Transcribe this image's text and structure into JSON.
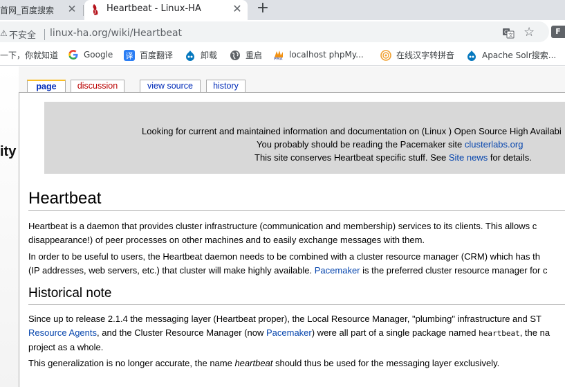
{
  "browser": {
    "tabs": [
      {
        "title": "首网_百度搜索",
        "active": false
      },
      {
        "title": "Heartbeat - Linux-HA",
        "active": true
      }
    ],
    "close_glyph": "✕",
    "new_tab_glyph": "+",
    "security_label": "不安全",
    "url": "linux-ha.org/wiki/Heartbeat",
    "profile_initial": "F",
    "bookmarks": [
      {
        "label": "一下，你就知道",
        "icon": "none"
      },
      {
        "label": "Google",
        "icon": "google-icon"
      },
      {
        "label": "百度翻译",
        "icon": "baidu-translate-icon"
      },
      {
        "label": "卸载",
        "icon": "drupal-icon"
      },
      {
        "label": "重启",
        "icon": "globe-icon"
      },
      {
        "label": "localhost phpMy...",
        "icon": "phpmyadmin-icon"
      },
      {
        "label": "在线汉字转拼音",
        "icon": "pinyin-icon"
      },
      {
        "label": "Apache Solr搜索...",
        "icon": "drupal-icon"
      }
    ]
  },
  "wiki": {
    "logo_fragment": "ity",
    "tabs": {
      "page": "page",
      "discussion": "discussion",
      "view_source": "view source",
      "history": "history"
    },
    "notice": {
      "line1": "Looking for current and maintained information and documentation on (Linux ) Open Source High Availabi",
      "line2_prefix": "You probably should be reading the Pacemaker site ",
      "line2_link": "clusterlabs.org",
      "line3_prefix": "This site conserves Heartbeat specific stuff. See ",
      "line3_link": "Site news",
      "line3_suffix": " for details."
    },
    "title": "Heartbeat",
    "paragraph1": {
      "line1": "Heartbeat is a daemon that provides cluster infrastructure (communication and membership) services to its clients. This allows c",
      "line2": "disappearance!) of peer processes on other machines and to easily exchange messages with them."
    },
    "paragraph2": {
      "line1": "In order to be useful to users, the Heartbeat daemon needs to be combined with a cluster resource manager (CRM) which has th",
      "line2_prefix": "(IP addresses, web servers, etc.) that cluster will make highly available. ",
      "line2_link": "Pacemaker",
      "line2_suffix": " is the preferred cluster resource manager for c"
    },
    "section_heading": "Historical note",
    "paragraph3": {
      "line1": "Since up to release 2.1.4 the messaging layer (Heartbeat proper), the Local Resource Manager, \"plumbing\" infrastructure and ST",
      "line2_link1": "Resource Agents",
      "line2_mid": ", and the Cluster Resource Manager (now ",
      "line2_link2": "Pacemaker",
      "line2_mid2": ") were all part of a single package named ",
      "line2_code": "heartbeat",
      "line2_suffix": ", the na",
      "line3": "project as a whole."
    },
    "paragraph4": {
      "prefix": "This generalization is no longer accurate, the name ",
      "em": "heartbeat",
      "suffix": " should thus be used for the messaging layer exclusively."
    }
  }
}
